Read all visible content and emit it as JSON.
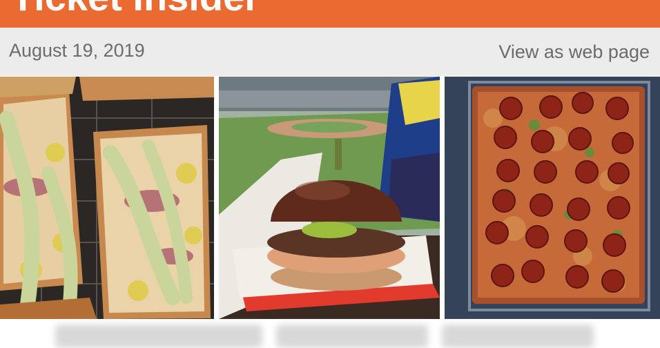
{
  "header": {
    "title": "Ticket Insider",
    "background_color": "#ea6a31",
    "text_color": "#ffffff"
  },
  "meta": {
    "date": "August 19, 2019",
    "web_page_link": "View as web page",
    "bar_color": "#ececec",
    "text_color": "#6b6b6b"
  },
  "photos": [
    {
      "subject": "flatbread pizza slices with drizzle"
    },
    {
      "subject": "burger on pretzel bun in stadium"
    },
    {
      "subject": "square pepperoni pizza on rack"
    }
  ]
}
